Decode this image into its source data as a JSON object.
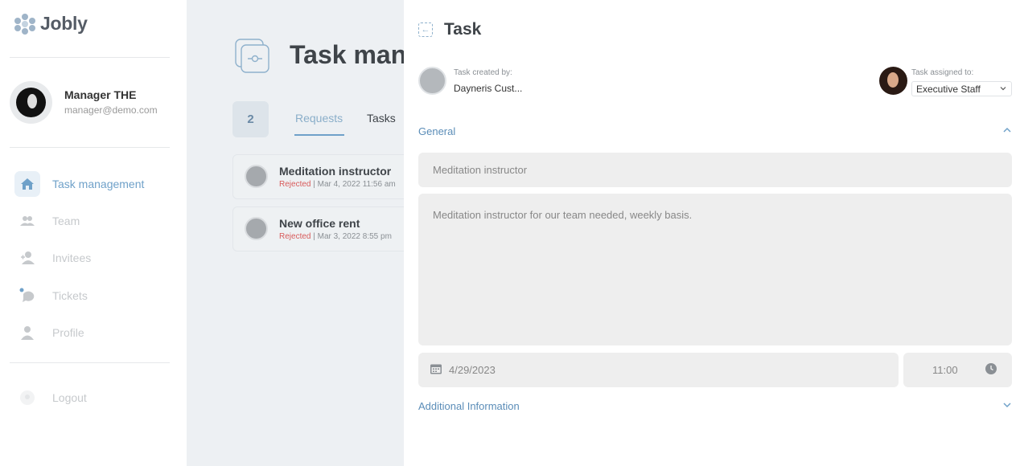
{
  "app": {
    "logo_text": "Jobly"
  },
  "user": {
    "name": "Manager THE",
    "email": "manager@demo.com"
  },
  "nav": {
    "items": [
      {
        "label": "Task management",
        "icon": "home-icon",
        "active": true
      },
      {
        "label": "Team",
        "icon": "team-icon"
      },
      {
        "label": "Invitees",
        "icon": "add-user-icon"
      },
      {
        "label": "Tickets",
        "icon": "chat-icon"
      },
      {
        "label": "Profile",
        "icon": "person-icon"
      }
    ],
    "logout": "Logout"
  },
  "main": {
    "title": "Task mana",
    "count": "2",
    "tabs": [
      "Requests",
      "Tasks"
    ],
    "cards": [
      {
        "title": "Meditation instructor",
        "status": "Rejected",
        "date": " | Mar 4, 2022 11:56 am"
      },
      {
        "title": "New office rent",
        "status": "Rejected",
        "date": " | Mar 3, 2022 8:55 pm"
      }
    ]
  },
  "panel": {
    "title": "Task",
    "creator_label": "Task created by:",
    "creator_name": "Dayneris Cust...",
    "assignee_label": "Task assigned to:",
    "assignee_value": "Executive Staff",
    "general_label": "General",
    "task_title": "Meditation instructor",
    "task_description": "Meditation instructor for our team needed, weekly basis.",
    "date": "4/29/2023",
    "time": "11:00",
    "additional_label": "Additional Information"
  },
  "colors": {
    "accent": "#6fa1c9",
    "rejected": "#d85b5b",
    "field_bg": "#eeeeee"
  }
}
